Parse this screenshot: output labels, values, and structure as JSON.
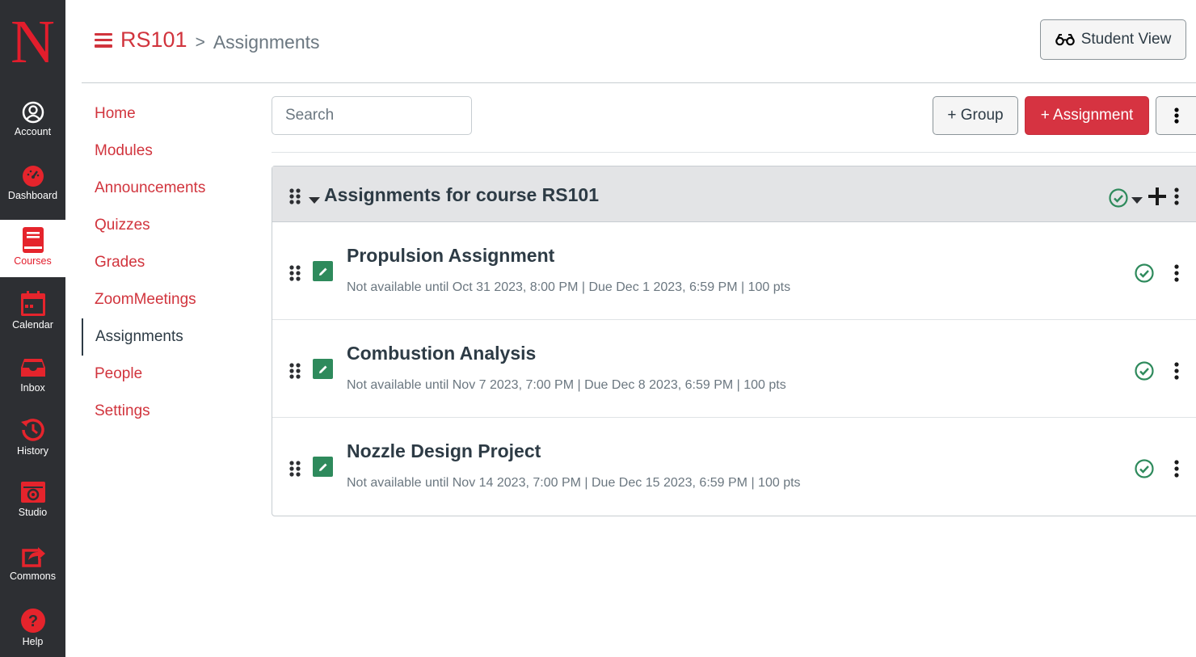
{
  "global_nav": {
    "logo_letter": "N",
    "items": [
      {
        "label": "Account",
        "icon": "account-icon"
      },
      {
        "label": "Dashboard",
        "icon": "dashboard-icon"
      },
      {
        "label": "Courses",
        "icon": "courses-icon",
        "active": true
      },
      {
        "label": "Calendar",
        "icon": "calendar-icon"
      },
      {
        "label": "Inbox",
        "icon": "inbox-icon"
      },
      {
        "label": "History",
        "icon": "history-icon"
      },
      {
        "label": "Studio",
        "icon": "studio-icon"
      },
      {
        "label": "Commons",
        "icon": "commons-icon"
      },
      {
        "label": "Help",
        "icon": "help-icon"
      }
    ]
  },
  "header": {
    "course": "RS101",
    "separator": ">",
    "page": "Assignments",
    "student_view_label": "Student View"
  },
  "course_nav": {
    "items": [
      "Home",
      "Modules",
      "Announcements",
      "Quizzes",
      "Grades",
      "ZoomMeetings",
      "Assignments",
      "People",
      "Settings"
    ],
    "active": "Assignments"
  },
  "toolbar": {
    "search_placeholder": "Search",
    "add_group_label": "+ Group",
    "add_assignment_label": "+ Assignment"
  },
  "group": {
    "title": "Assignments for course RS101",
    "assignments": [
      {
        "name": "Propulsion Assignment",
        "meta": "Not available until Oct 31 2023, 8:00 PM | Due Dec 1 2023, 6:59 PM | 100 pts",
        "published": true
      },
      {
        "name": "Combustion Analysis",
        "meta": "Not available until Nov 7 2023, 7:00 PM | Due Dec 8 2023, 6:59 PM | 100 pts",
        "published": true
      },
      {
        "name": "Nozzle Design Project",
        "meta": "Not available until Nov 14 2023, 7:00 PM | Due Dec 15 2023, 6:59 PM | 100 pts",
        "published": true
      }
    ]
  },
  "colors": {
    "brand_red": "#d1343d",
    "nav_bg": "#2d2f33",
    "published_green": "#2e8a5c"
  }
}
